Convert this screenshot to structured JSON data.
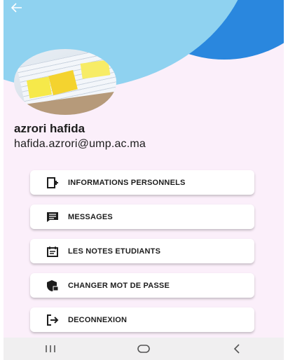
{
  "header": {
    "back_icon": "arrow-left-icon"
  },
  "profile": {
    "name": "azrori hafida",
    "email": "hafida.azrori@ump.ac.ma"
  },
  "menu": [
    {
      "label": "INFORMATIONS PERSONNELS",
      "icon": "person-card-icon"
    },
    {
      "label": "MESSAGES",
      "icon": "message-icon"
    },
    {
      "label": "LES NOTES ETUDIANTS",
      "icon": "notes-icon"
    },
    {
      "label": "CHANGER MOT DE PASSE",
      "icon": "shield-lock-icon"
    },
    {
      "label": "DECONNEXION",
      "icon": "logout-icon"
    }
  ],
  "navbar": {
    "recents_icon": "recents-icon",
    "home_icon": "home-icon",
    "back_icon": "back-chevron-icon"
  },
  "colors": {
    "background": "#fbeffa",
    "wave_dark": "#2a87de",
    "wave_light": "#8fd2f0"
  }
}
